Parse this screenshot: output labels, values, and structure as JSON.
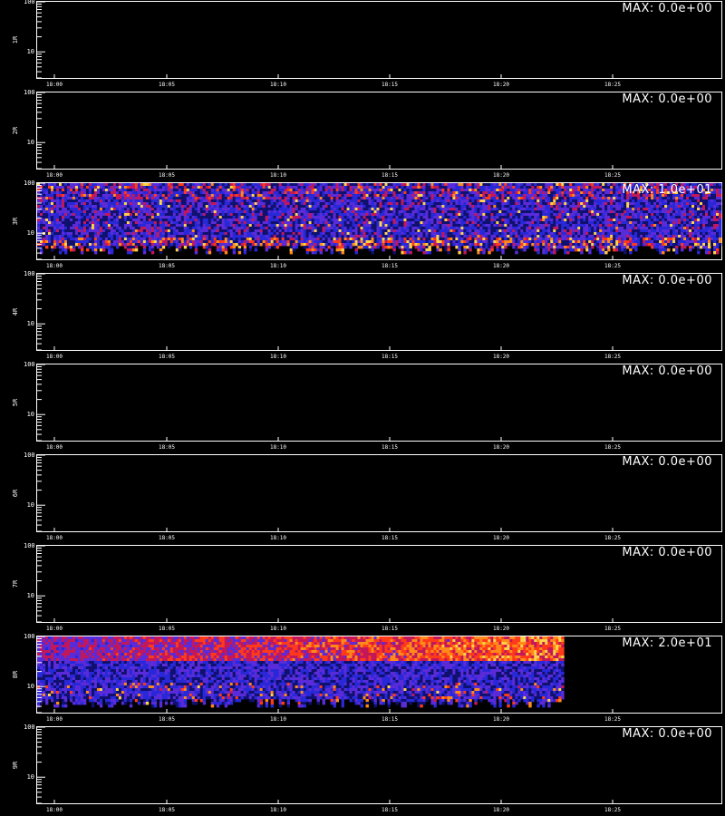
{
  "colors": {
    "background": "#000000",
    "axis": "#ffffff",
    "colormap": [
      "#000000",
      "#10106e",
      "#2828d8",
      "#5a2bd8",
      "#c2185b",
      "#ff3a1a",
      "#ff8a1a",
      "#ffd24a"
    ]
  },
  "chart_data": [
    {
      "type": "heatmap",
      "ylabel": "1R",
      "max_label": "MAX: 0.0e+00",
      "max_value": 0.0,
      "y_scale": "log",
      "ylim": [
        3,
        100
      ],
      "y_tick_labels": [
        "100",
        "10"
      ],
      "x_tick_labels": [
        "18:00",
        "18:05",
        "18:10",
        "18:15",
        "18:20",
        "18:25"
      ],
      "data_fill_fraction": 0.0
    },
    {
      "type": "heatmap",
      "ylabel": "2R",
      "max_label": "MAX: 0.0e+00",
      "max_value": 0.0,
      "y_scale": "log",
      "ylim": [
        3,
        100
      ],
      "y_tick_labels": [
        "100",
        "10"
      ],
      "x_tick_labels": [
        "18:00",
        "18:05",
        "18:10",
        "18:15",
        "18:20",
        "18:25"
      ],
      "data_fill_fraction": 0.0
    },
    {
      "type": "heatmap",
      "ylabel": "3R",
      "max_label": "MAX: 1.0e+01",
      "max_value": 10.0,
      "y_scale": "log",
      "ylim": [
        3,
        100
      ],
      "y_tick_labels": [
        "100",
        "10"
      ],
      "x_tick_labels": [
        "18:00",
        "18:05",
        "18:10",
        "18:15",
        "18:20",
        "18:25"
      ],
      "data_fill_fraction": 1.0
    },
    {
      "type": "heatmap",
      "ylabel": "4R",
      "max_label": "MAX: 0.0e+00",
      "max_value": 0.0,
      "y_scale": "log",
      "ylim": [
        3,
        100
      ],
      "y_tick_labels": [
        "100",
        "10"
      ],
      "x_tick_labels": [
        "18:00",
        "18:05",
        "18:10",
        "18:15",
        "18:20",
        "18:25"
      ],
      "data_fill_fraction": 0.0
    },
    {
      "type": "heatmap",
      "ylabel": "5R",
      "max_label": "MAX: 0.0e+00",
      "max_value": 0.0,
      "y_scale": "log",
      "ylim": [
        3,
        100
      ],
      "y_tick_labels": [
        "100",
        "10"
      ],
      "x_tick_labels": [
        "18:00",
        "18:05",
        "18:10",
        "18:15",
        "18:20",
        "18:25"
      ],
      "data_fill_fraction": 0.0
    },
    {
      "type": "heatmap",
      "ylabel": "6R",
      "max_label": "MAX: 0.0e+00",
      "max_value": 0.0,
      "y_scale": "log",
      "ylim": [
        3,
        100
      ],
      "y_tick_labels": [
        "100",
        "10"
      ],
      "x_tick_labels": [
        "18:00",
        "18:05",
        "18:10",
        "18:15",
        "18:20",
        "18:25"
      ],
      "data_fill_fraction": 0.0
    },
    {
      "type": "heatmap",
      "ylabel": "7R",
      "max_label": "MAX: 0.0e+00",
      "max_value": 0.0,
      "y_scale": "log",
      "ylim": [
        3,
        100
      ],
      "y_tick_labels": [
        "100",
        "10"
      ],
      "x_tick_labels": [
        "18:00",
        "18:05",
        "18:10",
        "18:15",
        "18:20",
        "18:25"
      ],
      "data_fill_fraction": 0.0
    },
    {
      "type": "heatmap",
      "ylabel": "8R",
      "max_label": "MAX: 2.0e+01",
      "max_value": 20.0,
      "y_scale": "log",
      "ylim": [
        3,
        100
      ],
      "y_tick_labels": [
        "100",
        "10"
      ],
      "x_tick_labels": [
        "18:00",
        "18:05",
        "18:10",
        "18:15",
        "18:20",
        "18:25"
      ],
      "data_fill_fraction": 0.77
    },
    {
      "type": "heatmap",
      "ylabel": "9R",
      "max_label": "MAX: 0.0e+00",
      "max_value": 0.0,
      "y_scale": "log",
      "ylim": [
        3,
        100
      ],
      "y_tick_labels": [
        "100",
        "10"
      ],
      "x_tick_labels": [
        "18:00",
        "18:05",
        "18:10",
        "18:15",
        "18:20",
        "18:25"
      ],
      "data_fill_fraction": 0.0
    }
  ]
}
